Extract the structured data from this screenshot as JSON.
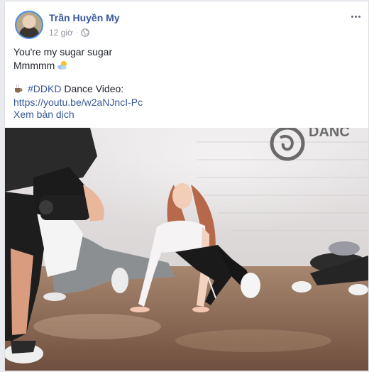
{
  "post": {
    "author": "Trần Huyền My",
    "time": "12 giờ",
    "separator": "·",
    "privacy_icon": "globe-icon",
    "menu_icon": "more-options-icon",
    "lines": {
      "line1": "You're my sugar sugar",
      "line2": "Mmmmm",
      "hashtag": "#DDKD",
      "video_label": " Dance Video:",
      "link": "https://youtu.be/w2aNJncI-Pc"
    },
    "emojis": {
      "line2": "sun-behind-cloud-emoji",
      "line3": "hot-beverage-emoji"
    },
    "translate_label": "Xem bản dịch",
    "photo": {
      "description_icon": "dance-studio-photo",
      "wall_sign": "DANC"
    }
  }
}
